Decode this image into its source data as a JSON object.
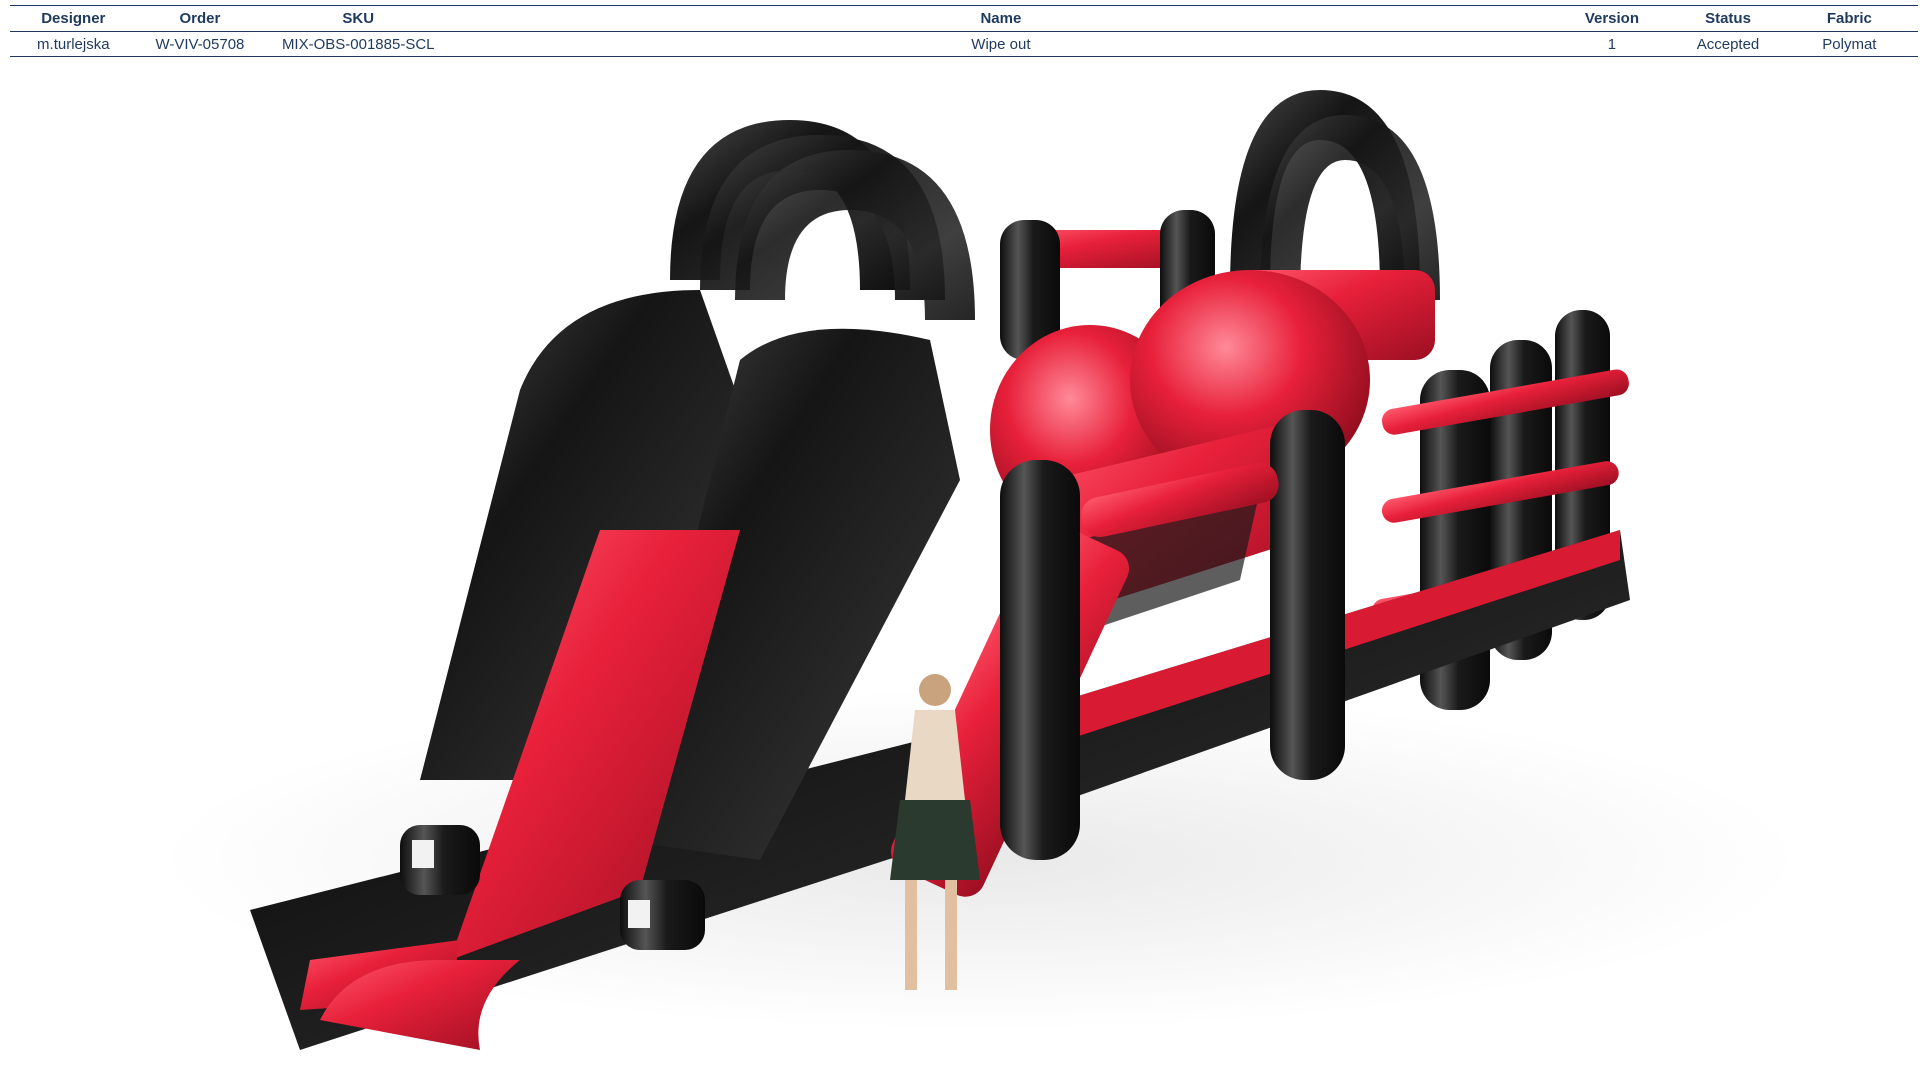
{
  "table": {
    "headers": {
      "designer": "Designer",
      "order": "Order",
      "sku": "SKU",
      "name": "Name",
      "version": "Version",
      "status": "Status",
      "fabric": "Fabric"
    },
    "row": {
      "designer": "m.turlejska",
      "order": "W-VIV-05708",
      "sku": "MIX-OBS-001885-SCL",
      "name": "Wipe out",
      "version": "1",
      "status": "Accepted",
      "fabric": "Polymat"
    }
  },
  "colors": {
    "text": "#1f3a5f",
    "inflatable_red": "#e8203a",
    "inflatable_black": "#1a1a1a"
  }
}
